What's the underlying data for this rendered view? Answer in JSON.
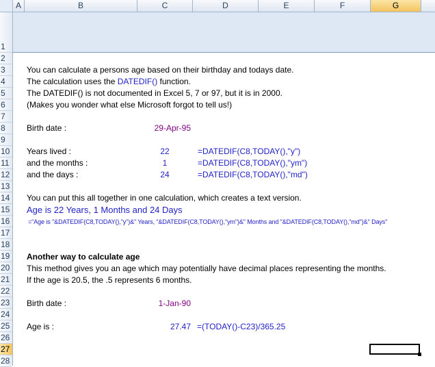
{
  "columns": [
    "A",
    "B",
    "C",
    "D",
    "E",
    "F",
    "G"
  ],
  "rows": [
    "1",
    "2",
    "3",
    "4",
    "5",
    "6",
    "7",
    "8",
    "9",
    "10",
    "11",
    "12",
    "13",
    "14",
    "15",
    "16",
    "17",
    "18",
    "19",
    "20",
    "21",
    "22",
    "23",
    "24",
    "25",
    "26",
    "27",
    "28"
  ],
  "intro": {
    "line1": "You can calculate a persons age based on their birthday and todays date.",
    "line2_pre": "The calculation uses the ",
    "line2_func": "DATEDIF()",
    "line2_post": " function.",
    "line3": "The DATEDIF() is not documented in Excel 5, 7 or 97, but it is in 2000.",
    "line4": "(Makes you wonder what else Microsoft forgot to tell us!)"
  },
  "section1": {
    "birth_label": "Birth date :",
    "birth_value": "29-Apr-95",
    "years_label": "Years lived :",
    "years_value": "22",
    "years_formula": "=DATEDIF(C8,TODAY(),\"y\")",
    "months_label": "and the months :",
    "months_value": "1",
    "months_formula": "=DATEDIF(C8,TODAY(),\"ym\")",
    "days_label": "and the days :",
    "days_value": "24",
    "days_formula": "=DATEDIF(C8,TODAY(),\"md\")",
    "together_text": "You can put this all together in one calculation, which creates a text version.",
    "result_text": "Age is 22 Years, 1 Months and 24 Days",
    "combined_formula": "=\"Age is \"&DATEDIF(C8,TODAY(),\"y\")&\" Years, \"&DATEDIF(C8,TODAY(),\"ym\")&\" Months and \"&DATEDIF(C8,TODAY(),\"md\")&\" Days\""
  },
  "section2": {
    "heading": "Another way to calculate age",
    "desc1": "This method gives you an age which may potentially have decimal places representing the months.",
    "desc2": "If the age is 20.5, the .5 represents 6 months.",
    "birth_label": "Birth date :",
    "birth_value": "1-Jan-90",
    "age_label": "Age is :",
    "age_value": "27.47",
    "age_formula": "=(TODAY()-C23)/365.25"
  },
  "selected_cell": "G27",
  "colors": {
    "purple": "#7f007f",
    "blue": "#1f1fc8",
    "header_band": "#dde8f4"
  }
}
